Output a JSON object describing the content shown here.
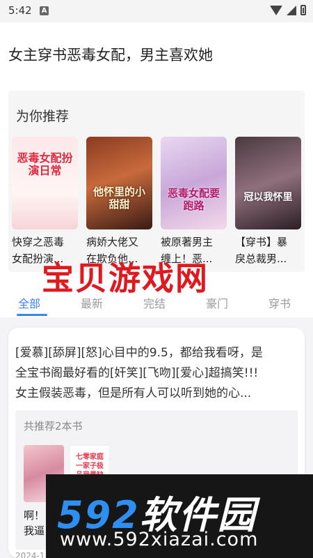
{
  "status_bar": {
    "time": "5:42",
    "a_badge": "A"
  },
  "page_title": "女主穿书恶毒女配，男主喜欢她",
  "recommend": {
    "title": "为你推荐",
    "books": [
      {
        "name_line1": "快穿之恶毒",
        "name_line2": "女配扮演...",
        "cover_text": "恶毒女配扮演日常",
        "cover_icon": "book-cover-1"
      },
      {
        "name_line1": "病娇大佬又",
        "name_line2": "在欺负他...",
        "cover_text": "他怀里的小甜甜",
        "cover_icon": "book-cover-2"
      },
      {
        "name_line1": "被原著男主",
        "name_line2": "缠上！恶...",
        "cover_text": "恶毒女配要跑路",
        "cover_icon": "book-cover-3"
      },
      {
        "name_line1": "【穿书】暴",
        "name_line2": "戾总裁男...",
        "cover_text": "冠以我怀里",
        "cover_icon": "book-cover-4"
      }
    ]
  },
  "watermark_text": "宝贝游戏网",
  "tabs": [
    {
      "label": "全部",
      "active": true
    },
    {
      "label": "最新",
      "active": false
    },
    {
      "label": "完结",
      "active": false
    },
    {
      "label": "豪门",
      "active": false
    },
    {
      "label": "穿书",
      "active": false
    }
  ],
  "post": {
    "line1": "[爱慕][舔屏][怒]心目中的9.5，都给我看呀，是",
    "line2": "全宝书阁最好看的[奸笑][飞吻][爱心]超搞笑!!!",
    "line3": "女主假装恶毒，但是所有人可以听到她的心...",
    "recbox_title": "共推荐2本书",
    "mini_cover2_text": "七零家庭一家子极品我最缺德",
    "mini_title_line1": "啊！",
    "mini_title_line2": "我逼",
    "date": "2024-1"
  },
  "banner": {
    "logo_num": "592",
    "logo_cn": "软件园",
    "url": "www.592xiazai.com"
  },
  "colors": {
    "accent": "#3b82f6",
    "watermark": "#e0191f",
    "banner_blue": "#2f8ff0"
  }
}
